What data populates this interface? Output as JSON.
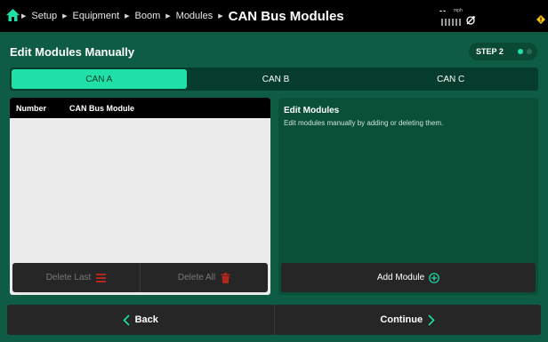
{
  "breadcrumb": {
    "items": [
      "Setup",
      "Equipment",
      "Boom",
      "Modules"
    ],
    "current": "CAN Bus Modules"
  },
  "status": {
    "speed_value": "--",
    "speed_unit": "mph"
  },
  "page": {
    "title": "Edit Modules Manually",
    "step_label": "STEP 2"
  },
  "tabs": [
    {
      "label": "CAN A",
      "active": true
    },
    {
      "label": "CAN B",
      "active": false
    },
    {
      "label": "CAN C",
      "active": false
    }
  ],
  "table": {
    "columns": [
      "Number",
      "CAN Bus Module"
    ],
    "rows": [],
    "delete_last_label": "Delete Last",
    "delete_all_label": "Delete All"
  },
  "edit_panel": {
    "title": "Edit Modules",
    "description": "Edit modules manually by adding or deleting them.",
    "add_label": "Add Module"
  },
  "navigation": {
    "back_label": "Back",
    "continue_label": "Continue"
  },
  "colors": {
    "accent": "#1fe0a7",
    "background": "#0d5c43",
    "danger": "#b3261e"
  }
}
